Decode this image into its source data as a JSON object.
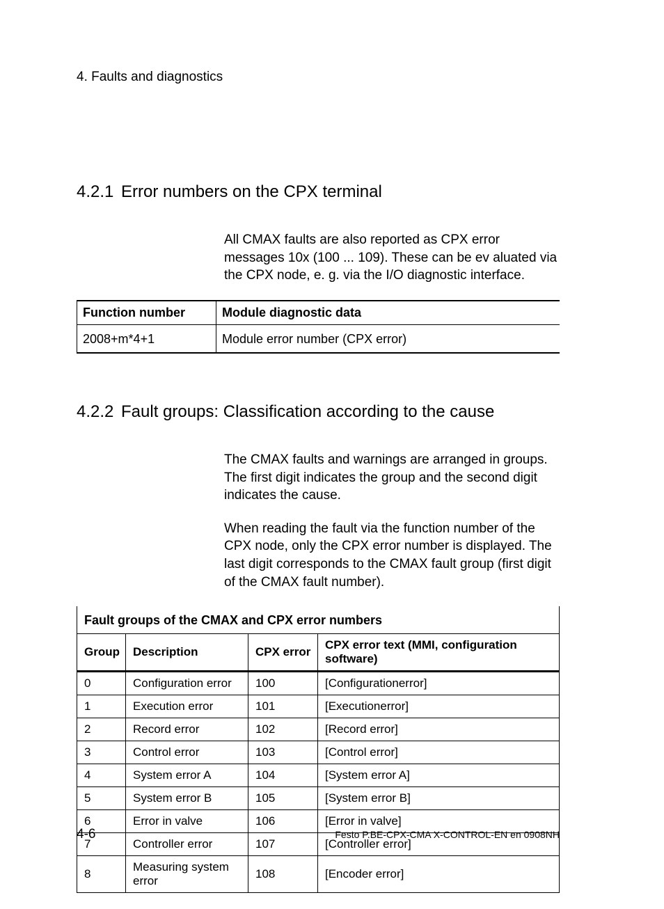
{
  "chapter": "4.   Faults and diagnostics",
  "section421": {
    "num": "4.2.1",
    "title": "Error numbers on the CPX terminal",
    "para": "All CMAX faults are also reported as CPX error messages 10x (100 ... 109). These can be ev aluated via the CPX node, e. g. via the I/O diagnostic interface."
  },
  "table1": {
    "headers": {
      "c1": "Function number",
      "c2": "Module diagnostic data"
    },
    "row": {
      "c1": "2008+m*4+1",
      "c2": "Module error number (CPX error)"
    }
  },
  "section422": {
    "num": "4.2.2",
    "title": "Fault groups: Classification according to the cause",
    "para1": "The CMAX faults and warnings are arranged in groups. The first digit indicates the group and the second digit indicates the cause.",
    "para2": "When reading the fault via the function number of the CPX node, only the CPX error number is displayed. The last digit corresponds to the CMAX fault group (first digit of the CMAX fault number)."
  },
  "table2": {
    "caption": "Fault groups of the CMAX and CPX error numbers",
    "headers": {
      "group": "Group",
      "desc": "Description",
      "cpxerr": "CPX error",
      "cpxtext": "CPX error text (MMI, configuration software)"
    },
    "rows": [
      {
        "group": "0",
        "desc": "Configuration error",
        "cpxerr": "100",
        "cpxtext": "[Configurationerror]"
      },
      {
        "group": "1",
        "desc": "Execution error",
        "cpxerr": "101",
        "cpxtext": "[Executionerror]"
      },
      {
        "group": "2",
        "desc": "Record error",
        "cpxerr": "102",
        "cpxtext": "[Record error]"
      },
      {
        "group": "3",
        "desc": "Control error",
        "cpxerr": "103",
        "cpxtext": "[Control error]"
      },
      {
        "group": "4",
        "desc": "System error A",
        "cpxerr": "104",
        "cpxtext": "[System error A]"
      },
      {
        "group": "5",
        "desc": "System error B",
        "cpxerr": "105",
        "cpxtext": "[System error B]"
      },
      {
        "group": "6",
        "desc": "Error in valve",
        "cpxerr": "106",
        "cpxtext": "[Error in valve]"
      },
      {
        "group": "7",
        "desc": "Controller error",
        "cpxerr": "107",
        "cpxtext": "[Controller error]"
      },
      {
        "group": "8",
        "desc": "Measuring system error",
        "cpxerr": "108",
        "cpxtext": "[Encoder error]"
      }
    ]
  },
  "footer": {
    "page": "4-6",
    "docid": "Festo  P.BE-CPX-CMA X-CONTROL-EN   en 0908NH"
  }
}
